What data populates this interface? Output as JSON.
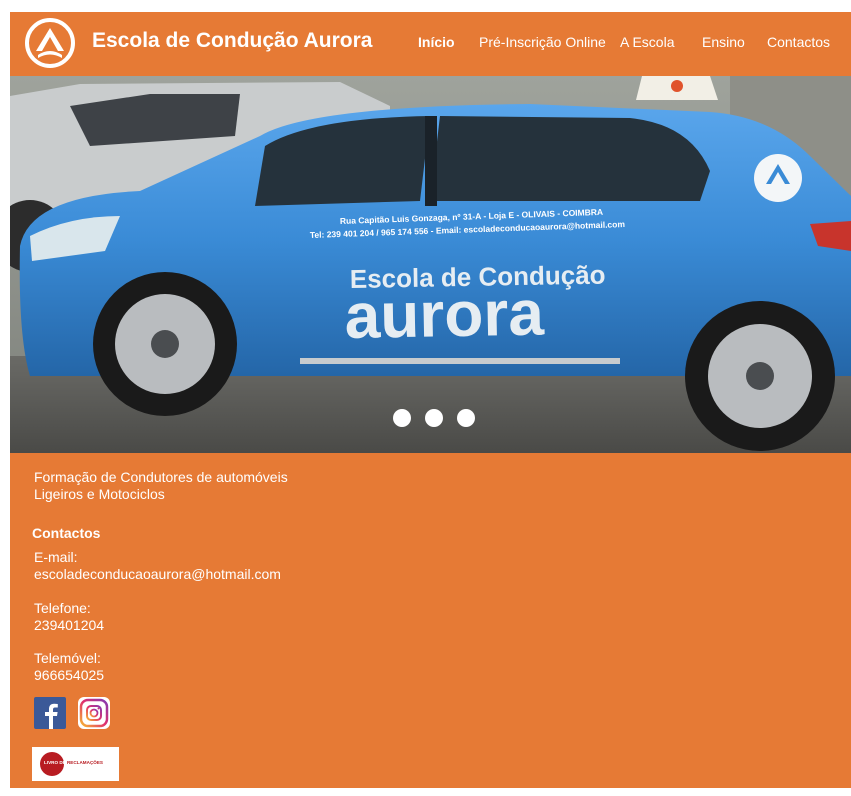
{
  "header": {
    "brand": "Escola de Condução Aurora",
    "logo_icon": "aurora-logo-icon",
    "nav": [
      {
        "label": "Início",
        "active": true
      },
      {
        "label": "Pré-Inscrição Online",
        "active": false
      },
      {
        "label": "A Escola",
        "active": false
      },
      {
        "label": "Ensino",
        "active": false
      },
      {
        "label": "Contactos",
        "active": false
      }
    ]
  },
  "hero": {
    "car_text": {
      "address": "Rua Capitão Luis Gonzaga, nº 31-A - Loja E - OLIVAIS - COIMBRA",
      "phones": "Tel: 239 401 204 / 965 174 556 - Email: escoladeconducaoaurora@hotmail.com",
      "school_line1": "Escola de Condução",
      "school_line2": "aurora"
    },
    "slides": 3,
    "active_slide": 1
  },
  "content": {
    "tagline": "Formação de Condutores de automóveis Ligeiros e Motociclos",
    "contacts_title": "Contactos",
    "email_label": "E-mail:",
    "email_value": "escoladeconducaoaurora@hotmail.com",
    "phone_label": "Telefone:",
    "phone_value": "239401204",
    "mobile_label": "Telemóvel:",
    "mobile_value": "966654025",
    "social": [
      "facebook-icon",
      "instagram-icon"
    ],
    "complaints_book": {
      "part1": "LIVRO DE",
      "part2": "RECLAMAÇÕES"
    }
  },
  "colors": {
    "brand_orange": "#E67A35",
    "car_blue": "#3B8ED8",
    "facebook_blue": "#3b5998",
    "complaints_red": "#b81c22"
  }
}
